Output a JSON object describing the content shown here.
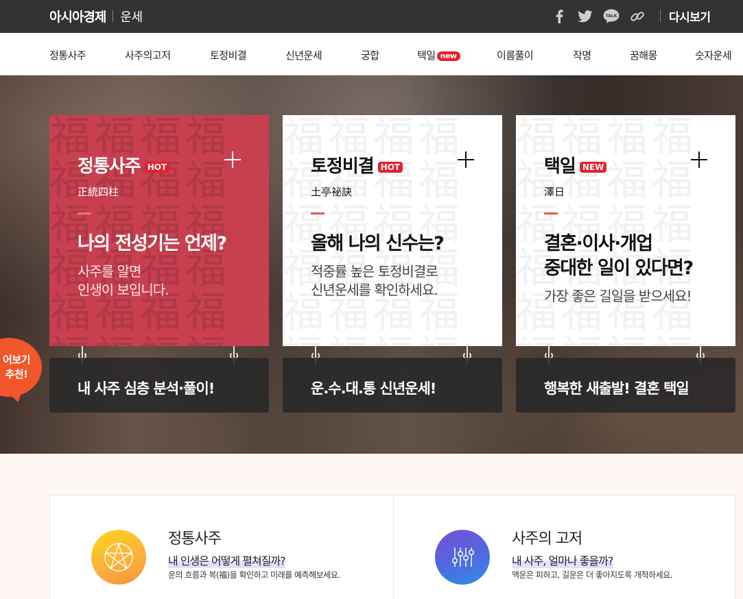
{
  "header": {
    "brand": "아시아경제",
    "section": "운세",
    "icons": [
      "facebook-icon",
      "twitter-icon",
      "kakaotalk-icon",
      "link-icon"
    ],
    "kakao_label": "TALK",
    "view_again": "다시보기"
  },
  "nav": {
    "items": [
      {
        "label": "정통사주"
      },
      {
        "label": "사주의고저"
      },
      {
        "label": "토정비결"
      },
      {
        "label": "신년운세"
      },
      {
        "label": "궁합"
      },
      {
        "label": "택일",
        "badge": "new"
      },
      {
        "label": "이름풀이"
      },
      {
        "label": "작명"
      },
      {
        "label": "꿈해몽"
      },
      {
        "label": "숫자운세"
      }
    ]
  },
  "hero": {
    "cards": [
      {
        "title": "정통사주",
        "badge": "HOT",
        "hanja": "正統四柱",
        "headline": "나의 전성기는 언제?",
        "desc": "사주를 알면\n인생이 보입니다.",
        "sign": "내 사주 심층 분석·풀이!"
      },
      {
        "title": "토정비결",
        "badge": "HOT",
        "hanja": "土亭祕訣",
        "headline": "올해 나의 신수는?",
        "desc": "적중률 높은 토정비결로\n신년운세를 확인하세요.",
        "sign": "운.수.대.통 신년운세!"
      },
      {
        "title": "택일",
        "badge": "NEW",
        "hanja": "澤日",
        "headline": "결혼·이사·개업\n중대한 일이 있다면?",
        "desc": "가장 좋은 길일을 받으세요!",
        "sign": "행복한 새출발! 결혼 택일"
      }
    ],
    "bubble": {
      "line1": "어보기",
      "line2": "추천!"
    },
    "pattern_text": "福福福福福福福福福福福福福福福福福福福福福福福福福福福福福福"
  },
  "services": [
    {
      "title": "정통사주",
      "subtitle": "내 인생은 어떻게 펼쳐질까?",
      "desc": "운의 흐름과 복(福)을 확인하고 미래를 예측해보세요.",
      "icon": "pentagram-circle-icon"
    },
    {
      "title": "사주의 고저",
      "subtitle": "내 사주, 얼마나 좋을까?",
      "desc": "액운은 피하고, 길운은 더 좋아지도록 개척하세요.",
      "icon": "equalizer-sliders-icon"
    }
  ],
  "colors": {
    "topbar": "#333333",
    "card_red": "#c8404f",
    "badge_red": "#e5202a",
    "bubble_orange": "#f2562a"
  }
}
